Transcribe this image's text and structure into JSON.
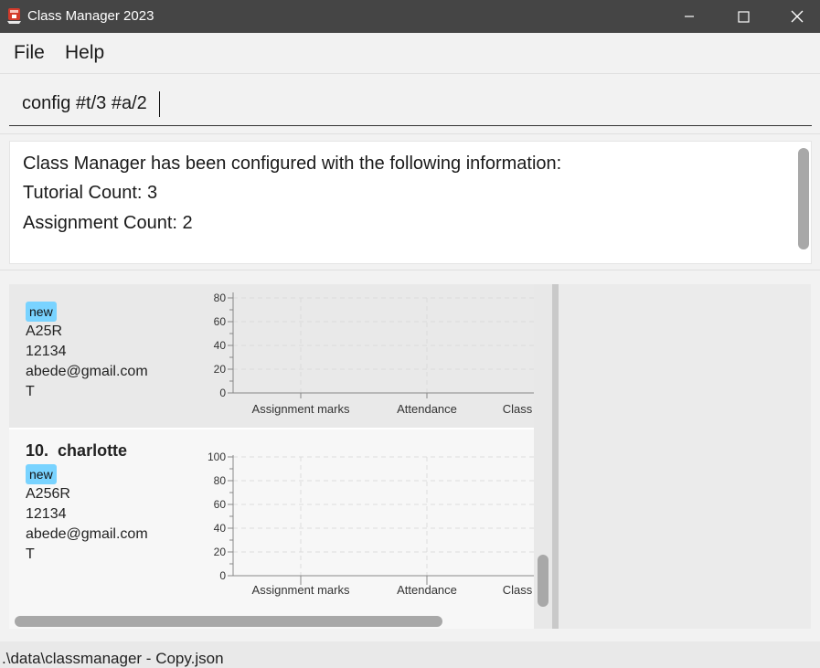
{
  "window": {
    "title": "Class Manager 2023"
  },
  "menu": {
    "file": "File",
    "help": "Help"
  },
  "command": {
    "value": "config #t/3 #a/2"
  },
  "result": {
    "lines": [
      "Class Manager has been configured with the following information:",
      "Tutorial Count: 3",
      "Assignment Count: 2"
    ]
  },
  "students": [
    {
      "index": "",
      "name": "",
      "tag": "new",
      "class_number": "A25R",
      "phone": "12134",
      "email": "abede@gmail.com",
      "extra": "T",
      "chart": {
        "y_ticks": [
          "80",
          "60",
          "40",
          "20",
          "0"
        ],
        "categories": [
          "Assignment marks",
          "Attendance",
          "Class"
        ]
      }
    },
    {
      "index": "10.",
      "name": "charlotte",
      "tag": "new",
      "class_number": "A256R",
      "phone": "12134",
      "email": "abede@gmail.com",
      "extra": "T",
      "chart": {
        "y_ticks": [
          "100",
          "80",
          "60",
          "40",
          "20",
          "0"
        ],
        "categories": [
          "Assignment marks",
          "Attendance",
          "Class"
        ]
      }
    }
  ],
  "status": {
    "file_path": ".\\data\\classmanager - Copy.json"
  },
  "icons": {
    "app": "app-icon",
    "minimize": "minimize-icon",
    "maximize": "maximize-icon",
    "close": "close-icon"
  },
  "colors": {
    "titlebar": "#454545",
    "tag": "#79d3ff",
    "scrollbar": "#a8a8a8"
  }
}
